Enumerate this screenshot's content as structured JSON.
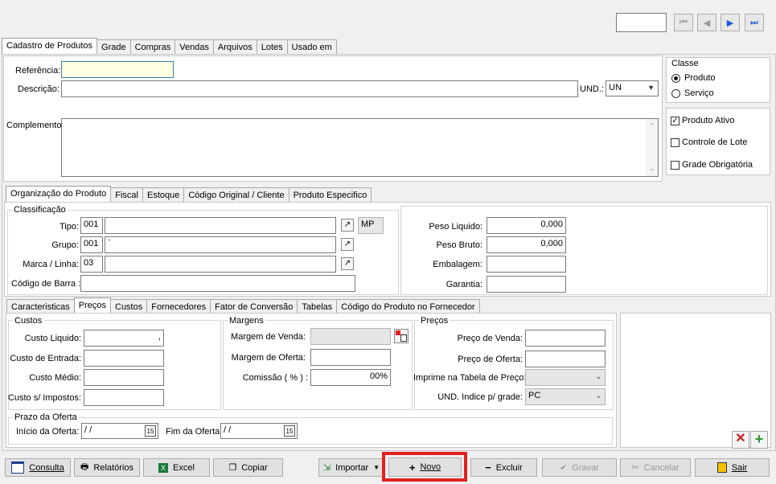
{
  "nav": {
    "first": "⏮",
    "prev": "◀",
    "next": "▶",
    "last": "⏭"
  },
  "main_tabs": [
    "Cadastro de Produtos",
    "Grade",
    "Compras",
    "Vendas",
    "Arquivos",
    "Lotes",
    "Usado em"
  ],
  "header": {
    "referencia_label": "Referência:",
    "descricao_label": "Descrição:",
    "und_label": "UND.:",
    "und_value": "UN",
    "complemento_label": "Complemento:"
  },
  "classe": {
    "title": "Classe",
    "produto": "Produto",
    "servico": "Serviço"
  },
  "flags": {
    "ativo": "Produto Ativo",
    "lote": "Controle de Lote",
    "grade": "Grade Obrigatória"
  },
  "org_tabs": [
    "Organização do Produto",
    "Fiscal",
    "Estoque",
    "Código Original / Cliente",
    "Produto Especifico"
  ],
  "classificacao": {
    "title": "Classificação",
    "tipo_label": "Tipo:",
    "tipo_code": "001",
    "tipo_extra": "MP",
    "grupo_label": "Grupo:",
    "grupo_code": "001",
    "grupo_desc": "`",
    "marca_label": "Marca / Linha:",
    "marca_code": "03",
    "barra_label": "Código de Barra :"
  },
  "pesos": {
    "liquido_label": "Peso Liquido:",
    "liquido_value": "0,000",
    "bruto_label": "Peso Bruto:",
    "bruto_value": "0,000",
    "embalagem_label": "Embalagem:",
    "garantia_label": "Garantia:"
  },
  "sub_tabs": [
    "Caracteristicas",
    "Preços",
    "Custos",
    "Fornecedores",
    "Fator de Conversão",
    "Tabelas",
    "Código do Produto no Fornecedor"
  ],
  "custos": {
    "title": "Custos",
    "liquido": "Custo Liquido:",
    "liquido_value": ",",
    "entrada": "Custo de Entrada:",
    "medio": "Custo Médio:",
    "impostos": "Custo s/ Impostos:"
  },
  "margens": {
    "title": "Margens",
    "venda": "Margem de Venda:",
    "oferta": "Margem de Oferta:",
    "comissao": "Comissão ( % ) :",
    "comissao_value": "00%"
  },
  "precos": {
    "title": "Preços",
    "venda": "Preço de Venda:",
    "oferta": "Preço de Oferta:",
    "tabela": "Imprime na Tabela de Preço:",
    "und": "UND. Indice p/ grade:",
    "und_value": "PC"
  },
  "prazo": {
    "title": "Prazo da Oferta",
    "inicio": "Início da Oferta:",
    "inicio_value": "/ /",
    "fim": "Fim da Oferta:",
    "fim_value": "/ /"
  },
  "buttons": {
    "consulta": "Consulta",
    "relatorios": "Relatórios",
    "excel": "Excel",
    "copiar": "Copiar",
    "importar": "Importar",
    "novo": "Novo",
    "excluir": "Excluir",
    "gravar": "Gravar",
    "cancelar": "Cancelar",
    "sair": "Sair"
  },
  "colors": {
    "highlight": "#e32020",
    "referencia_bg": "#ffffe1",
    "accent": "#1e5bd6"
  }
}
